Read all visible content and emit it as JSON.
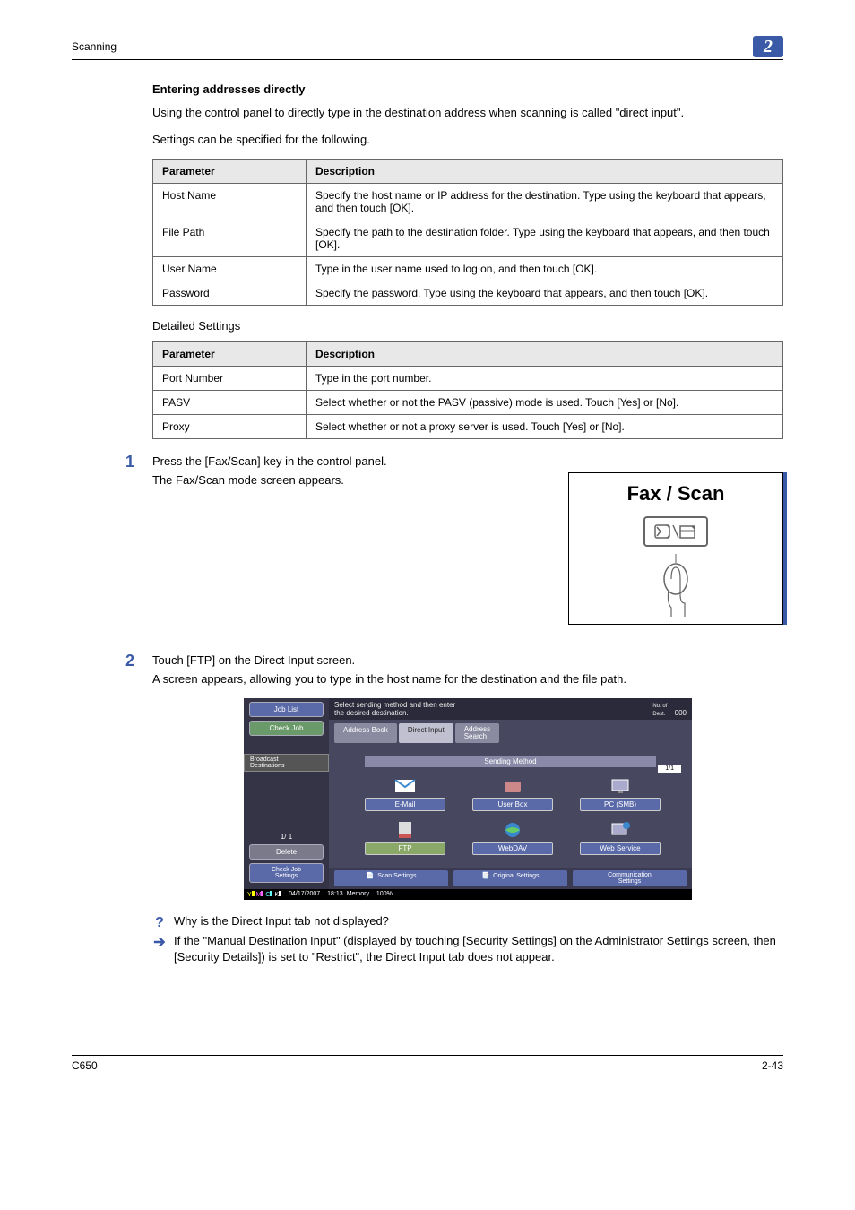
{
  "header": {
    "section": "Scanning",
    "chapter": "2"
  },
  "title": "Entering addresses directly",
  "intro1": "Using the control panel to directly type in the destination address when scanning is called \"direct input\".",
  "intro2": "Settings can be specified for the following.",
  "table1": {
    "head": {
      "c1": "Parameter",
      "c2": "Description"
    },
    "rows": [
      {
        "c1": "Host Name",
        "c2": "Specify the host name or IP address for the destination. Type using the keyboard that appears, and then touch [OK]."
      },
      {
        "c1": "File Path",
        "c2": "Specify the path to the destination folder. Type using the keyboard that appears, and then touch [OK]."
      },
      {
        "c1": "User Name",
        "c2": "Type in the user name used to log on, and then touch [OK]."
      },
      {
        "c1": "Password",
        "c2": "Specify the password. Type using the keyboard that appears, and then touch [OK]."
      }
    ]
  },
  "detailed_label": "Detailed Settings",
  "table2": {
    "head": {
      "c1": "Parameter",
      "c2": "Description"
    },
    "rows": [
      {
        "c1": "Port Number",
        "c2": "Type in the port number."
      },
      {
        "c1": "PASV",
        "c2": "Select whether or not the PASV (passive) mode is used. Touch [Yes] or [No]."
      },
      {
        "c1": "Proxy",
        "c2": "Select whether or not a proxy server is used. Touch [Yes] or [No]."
      }
    ]
  },
  "step1": {
    "num": "1",
    "line1": "Press the [Fax/Scan] key in the control panel.",
    "line2": "The Fax/Scan mode screen appears."
  },
  "fax_box": {
    "title": "Fax / Scan"
  },
  "step2": {
    "num": "2",
    "line1": "Touch [FTP] on the Direct Input screen.",
    "line2": "A screen appears, allowing you to type in the host name for the destination and the file path."
  },
  "screenshot": {
    "sidebar": {
      "job_list": "Job List",
      "check_job": "Check Job",
      "broadcast": "Broadcast\nDestinations",
      "pager": "1/ 1",
      "delete": "Delete",
      "check_settings": "Check Job\nSettings"
    },
    "topbar_left": "Select sending method and then enter\nthe desired destination.",
    "topbar_right_label": "No. of\nDest.",
    "topbar_right_value": "000",
    "tabs": {
      "t1": "Address Book",
      "t2": "Direct Input",
      "t3": "Address\nSearch"
    },
    "method_label": "Sending Method",
    "pager": "1/1",
    "methods": {
      "m1": "E-Mail",
      "m2": "User Box",
      "m3": "PC (SMB)",
      "m4": "FTP",
      "m5": "WebDAV",
      "m6": "Web Service"
    },
    "bottom": {
      "b1": "Scan Settings",
      "b2": "Original Settings",
      "b3": "Communication\nSettings"
    },
    "status": {
      "ymck": "Y M C K",
      "date": "04/17/2007",
      "time": "18:13",
      "memory": "Memory",
      "mem_val": "100%"
    }
  },
  "qa": {
    "q": "Why is the Direct Input tab not displayed?",
    "a": "If the \"Manual Destination Input\" (displayed by touching [Security Settings] on the Administrator Settings screen, then [Security Details]) is set to \"Restrict\", the Direct Input tab does not appear."
  },
  "footer": {
    "left": "C650",
    "right": "2-43"
  }
}
